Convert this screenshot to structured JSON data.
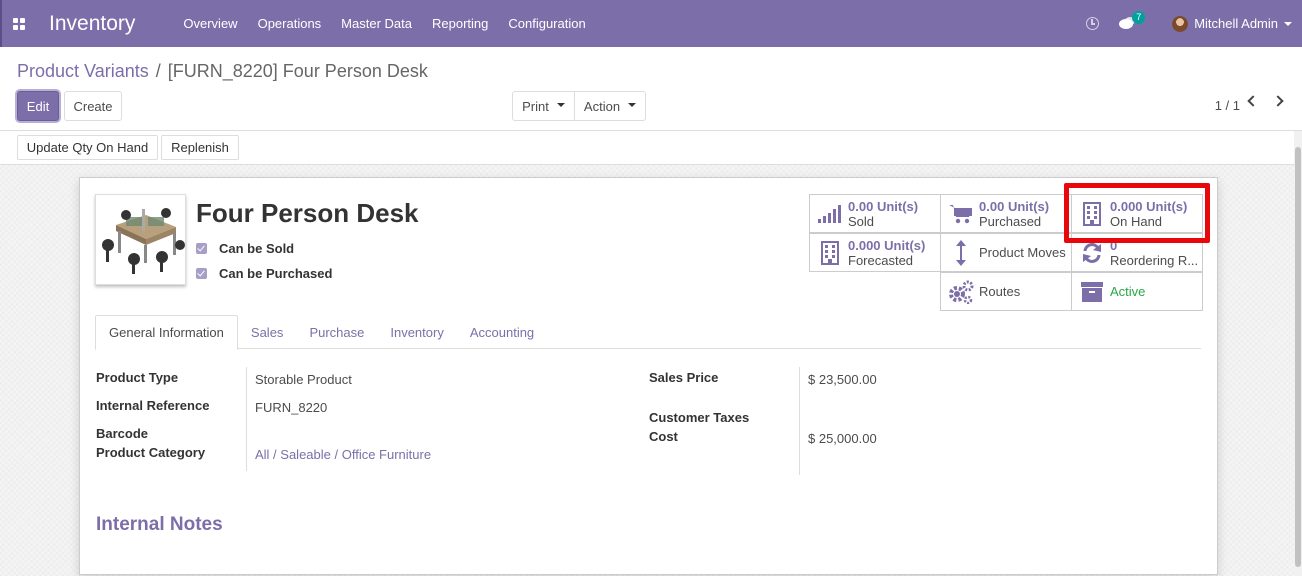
{
  "navbar": {
    "app_title": "Inventory",
    "menu": [
      "Overview",
      "Operations",
      "Master Data",
      "Reporting",
      "Configuration"
    ],
    "chat_count": "7",
    "user": "Mitchell Admin"
  },
  "breadcrumb": {
    "parent": "Product Variants",
    "separator": "/",
    "current": "[FURN_8220] Four Person Desk"
  },
  "buttons": {
    "edit": "Edit",
    "create": "Create",
    "print": "Print",
    "action": "Action"
  },
  "pager": {
    "value": "1 / 1"
  },
  "statusbar": {
    "update_qty": "Update Qty On Hand",
    "replenish": "Replenish"
  },
  "product": {
    "name": "Four Person Desk",
    "can_be_sold": "Can be Sold",
    "can_be_purchased": "Can be Purchased"
  },
  "smart_buttons": {
    "sold": {
      "value": "0.00",
      "unit": "Unit(s)",
      "label": "Sold"
    },
    "purchased": {
      "value": "0.00",
      "unit": "Unit(s)",
      "label": "Purchased"
    },
    "on_hand": {
      "value": "0.000",
      "unit": "Unit(s)",
      "label": "On Hand"
    },
    "forecasted": {
      "value": "0.000",
      "unit": "Unit(s)",
      "label": "Forecasted"
    },
    "product_moves": {
      "label": "Product Moves"
    },
    "reordering": {
      "value": "0",
      "label": "Reordering R..."
    },
    "routes": {
      "label": "Routes"
    },
    "active": {
      "label": "Active"
    }
  },
  "tabs": [
    "General Information",
    "Sales",
    "Purchase",
    "Inventory",
    "Accounting"
  ],
  "fields": {
    "product_type": {
      "label": "Product Type",
      "value": "Storable Product"
    },
    "internal_reference": {
      "label": "Internal Reference",
      "value": "FURN_8220"
    },
    "barcode": {
      "label": "Barcode",
      "value": ""
    },
    "product_category": {
      "label": "Product Category",
      "value": "All / Saleable / Office Furniture"
    },
    "sales_price": {
      "label": "Sales Price",
      "value": "$ 23,500.00"
    },
    "customer_taxes": {
      "label": "Customer Taxes",
      "value": ""
    },
    "cost": {
      "label": "Cost",
      "value": "$ 25,000.00"
    }
  },
  "internal_notes": {
    "title": "Internal Notes"
  },
  "colors": {
    "brand": "#7c6fa9",
    "active": "#28a745",
    "highlight": "#e8070b"
  }
}
